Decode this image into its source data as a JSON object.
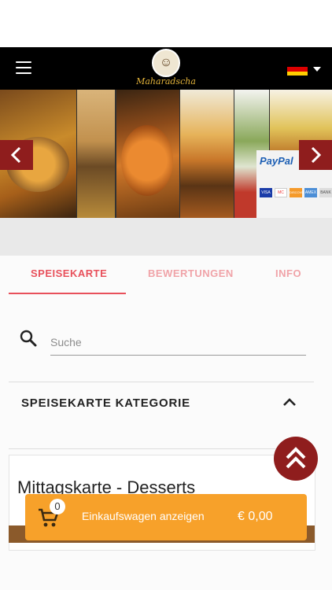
{
  "header": {
    "menu_icon": "hamburger-icon",
    "logo_text": "Maharadscha",
    "language_flag": "germany-flag-icon",
    "language_caret": "caret-down-icon"
  },
  "banner": {
    "prev_symbol": "‹",
    "next_symbol": "›",
    "paypal_text": "PayPal",
    "card_labels": [
      "VISA",
      "MC",
      "DISCOVER",
      "AMEX",
      "BANK"
    ]
  },
  "tabs": [
    {
      "label": "SPEISEKARTE",
      "active": true
    },
    {
      "label": "BEWERTUNGEN",
      "active": false
    },
    {
      "label": "INFO",
      "active": false
    }
  ],
  "search": {
    "placeholder": "Suche",
    "icon": "search-icon"
  },
  "category": {
    "title": "SPEISEKARTE KATEGORIE",
    "icon": "chevron-up-icon"
  },
  "menu_card": {
    "title": "Mittagskarte - Desserts"
  },
  "scroll_top": {
    "icon": "double-chevron-up-icon"
  },
  "cart": {
    "badge_count": "0",
    "label": "Einkaufswagen anzeigen",
    "price": "€ 0,00",
    "icon": "cart-icon"
  },
  "colors": {
    "accent": "#e8505b",
    "dark_red": "#8f1d1d",
    "cart_orange": "#f7a12a",
    "header_black": "#000000"
  }
}
